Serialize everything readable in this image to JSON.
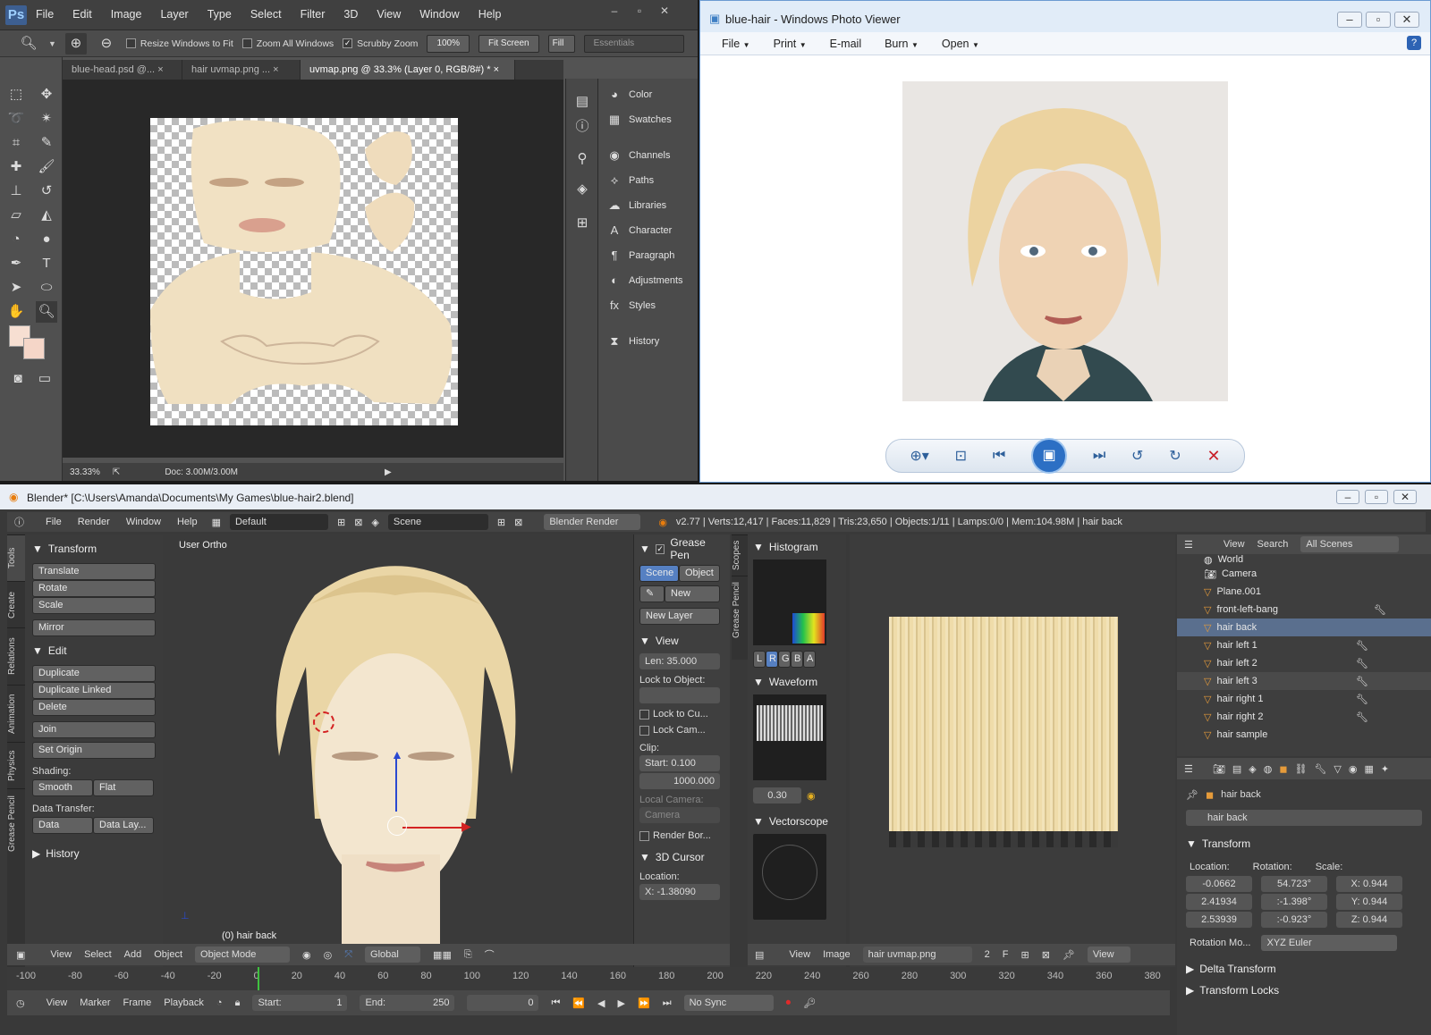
{
  "photoshop": {
    "logo": "Ps",
    "menu": [
      "File",
      "Edit",
      "Image",
      "Layer",
      "Type",
      "Select",
      "Filter",
      "3D",
      "View",
      "Window",
      "Help"
    ],
    "options": {
      "resize_windows": "Resize Windows to Fit",
      "zoom_all": "Zoom All Windows",
      "scrubby": "Scrubby Zoom",
      "zoom_value": "100%",
      "fit_screen": "Fit Screen",
      "fill": "Fill S",
      "workspace": "Essentials"
    },
    "tabs": [
      "blue-head.psd @...",
      "hair uvmap.png ...",
      "uvmap.png @ 33.3% (Layer 0, RGB/8#) *"
    ],
    "status": {
      "zoom": "33.33%",
      "doc": "Doc: 3.00M/3.00M"
    },
    "panels": [
      "Color",
      "Swatches",
      "Channels",
      "Paths",
      "Libraries",
      "Character",
      "Paragraph",
      "Adjustments",
      "Styles",
      "History"
    ]
  },
  "photoviewer": {
    "title": "blue-hair - Windows Photo Viewer",
    "menu": [
      "File",
      "Print",
      "E-mail",
      "Burn",
      "Open"
    ]
  },
  "blender": {
    "title": "Blender* [C:\\Users\\Amanda\\Documents\\My Games\\blue-hair2.blend]",
    "info_menu": [
      "File",
      "Render",
      "Window",
      "Help"
    ],
    "layout": "Default",
    "scene": "Scene",
    "engine": "Blender Render",
    "stats": "v2.77 | Verts:12,417 | Faces:11,829 | Tris:23,650 | Objects:1/11 | Lamps:0/0 | Mem:104.98M | hair back",
    "tool_tabs": [
      "Tools",
      "Create",
      "Relations",
      "Animation",
      "Physics",
      "Grease Pencil"
    ],
    "tools": {
      "transform_header": "Transform",
      "translate": "Translate",
      "rotate": "Rotate",
      "scale": "Scale",
      "mirror": "Mirror",
      "edit_header": "Edit",
      "duplicate": "Duplicate",
      "duplicate_linked": "Duplicate Linked",
      "delete": "Delete",
      "join": "Join",
      "set_origin": "Set Origin",
      "shading": "Shading:",
      "smooth": "Smooth",
      "flat": "Flat",
      "data_transfer": "Data Transfer:",
      "data": "Data",
      "data_layers": "Data Lay...",
      "history": "History"
    },
    "viewport": {
      "label": "User Ortho",
      "object": "(0) hair back"
    },
    "npanel": {
      "grease": "Grease Pen",
      "scene": "Scene",
      "object": "Object",
      "new": "New",
      "new_layer": "New Layer",
      "view": "View",
      "lens": "Len: 35.000",
      "lock_obj": "Lock to Object:",
      "lock_cursor": "Lock to Cu...",
      "lock_cam": "Lock Cam...",
      "clip": "Clip:",
      "start": "Start: 0.100",
      "end": "1000.000",
      "local_cam": "Local Camera:",
      "camera": "Camera",
      "render_border": "Render Bor...",
      "cursor": "3D Cursor",
      "location": "Location:",
      "x": "X: -1.38090"
    },
    "scopes": {
      "histogram": "Histogram",
      "channels": [
        "L",
        "R",
        "G",
        "B",
        "A"
      ],
      "waveform": "Waveform",
      "opacity": "0.30",
      "vectorscope": "Vectorscope",
      "tabs": [
        "Scopes",
        "Grease Pencil"
      ]
    },
    "outliner": {
      "view": "View",
      "search": "Search",
      "filter": "All Scenes",
      "items": [
        {
          "name": "World",
          "icon": "world-icon"
        },
        {
          "name": "Camera",
          "icon": "camera-icon"
        },
        {
          "name": "Plane.001",
          "icon": "mesh-icon"
        },
        {
          "name": "front-left-bang",
          "icon": "mesh-icon"
        },
        {
          "name": "hair back",
          "icon": "mesh-icon"
        },
        {
          "name": "hair left 1",
          "icon": "mesh-icon"
        },
        {
          "name": "hair left 2",
          "icon": "mesh-icon"
        },
        {
          "name": "hair left 3",
          "icon": "mesh-icon"
        },
        {
          "name": "hair right 1",
          "icon": "mesh-icon"
        },
        {
          "name": "hair right 2",
          "icon": "mesh-icon"
        },
        {
          "name": "hair sample",
          "icon": "mesh-icon"
        }
      ]
    },
    "properties": {
      "breadcrumb": "hair back",
      "name": "hair back",
      "transform": "Transform",
      "loc_label": "Location:",
      "rot_label": "Rotation:",
      "scale_label": "Scale:",
      "loc": [
        "-0.0662",
        "2.41934",
        "2.53939"
      ],
      "rot": [
        "54.723°",
        ":-1.398°",
        ":-0.923°"
      ],
      "scale": [
        "X: 0.944",
        "Y: 0.944",
        "Z: 0.944"
      ],
      "rot_mode_label": "Rotation Mo...",
      "rot_mode": "XYZ Euler",
      "delta": "Delta Transform",
      "locks": "Transform Locks"
    },
    "vheader": {
      "view": "View",
      "select": "Select",
      "add": "Add",
      "object": "Object",
      "mode": "Object Mode",
      "orient": "Global"
    },
    "iheader": {
      "view": "View",
      "image": "Image",
      "img_name": "hair uvmap.png",
      "users": "2",
      "fake": "F",
      "view2": "View"
    },
    "timeline_numbers": [
      "-100",
      "-80",
      "-60",
      "-40",
      "-20",
      "0",
      "20",
      "40",
      "60",
      "80",
      "100",
      "120",
      "140",
      "160",
      "180",
      "200",
      "220",
      "240",
      "260",
      "280",
      "300",
      "320",
      "340",
      "360",
      "380"
    ],
    "tlheader": {
      "view": "View",
      "marker": "Marker",
      "frame": "Frame",
      "playback": "Playback",
      "start": "Start:",
      "start_val": "1",
      "end": "End:",
      "end_val": "250",
      "current": "0",
      "sync": "No Sync"
    }
  }
}
